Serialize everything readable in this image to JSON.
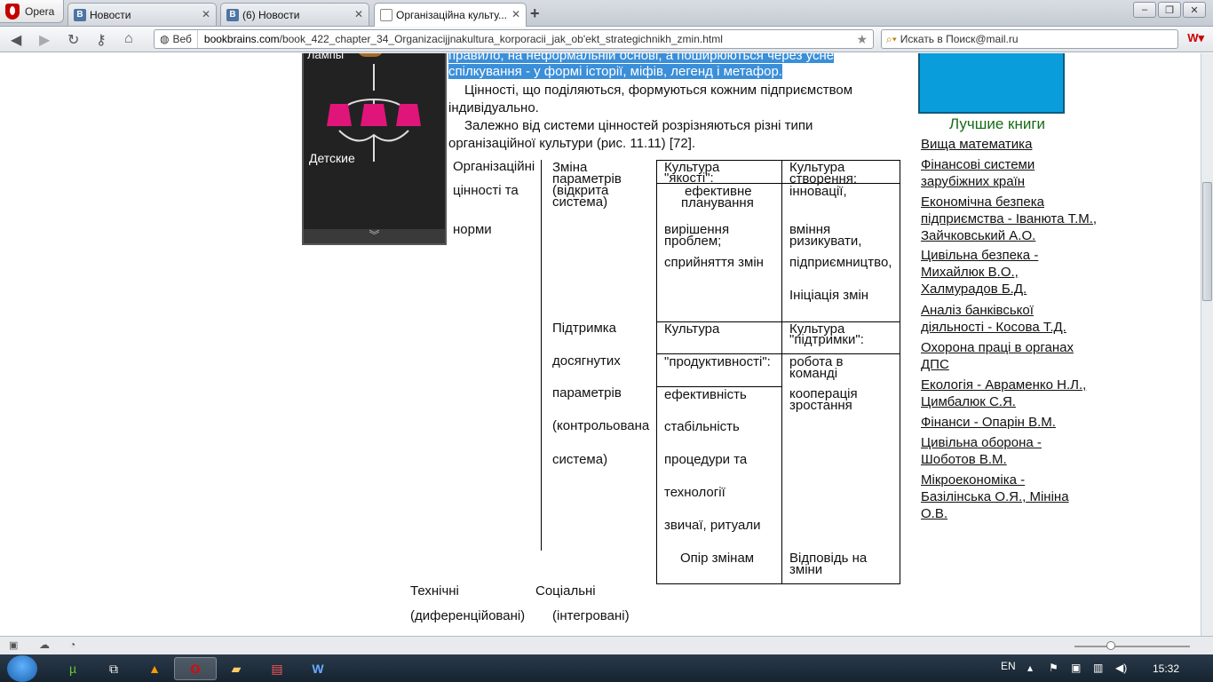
{
  "browser": {
    "menu_label": "Opera",
    "tabs": [
      {
        "label": "Новости",
        "icon": "vk-icon"
      },
      {
        "label": "(6) Новости",
        "icon": "vk-icon"
      },
      {
        "label": "Організаційна культу...",
        "icon": "document-icon"
      }
    ],
    "address": {
      "mode": "Веб",
      "domain": "bookbrains.com",
      "path": "/book_422_chapter_34_Organizacijjnakultura_korporacii_jak_ob'ekt_strategichnikh_zmin.html"
    },
    "search_placeholder": "Искать в Поиск@mail.ru",
    "window_controls": [
      "–",
      "❐",
      "✕"
    ]
  },
  "ad": {
    "title": "Лампы",
    "caption": "Детские"
  },
  "article": {
    "hl_line1": "правило, на неформальній основі, а поширюються через усне",
    "hl_line2": "спілкування - у формі історії, міфів, легенд і метафор.",
    "para1_line1": "Цінності, що поділяються, формуються кожним підприємством",
    "para1_line2": "індивідуально.",
    "para2_line1": "Залежно від системи цінностей розрізняються різні типи",
    "para2_line2": "організаційної культури (рис. 11.11) [72]."
  },
  "figure": {
    "left_label": [
      "Організаційні",
      "цінності та",
      "норми"
    ],
    "row1_label": [
      "Зміна",
      "параметрів",
      "(відкрита",
      "система)"
    ],
    "row2_label": [
      "Підтримка",
      "досягнутих",
      "параметрів",
      "(контрольована",
      "система)"
    ],
    "quality_title": [
      "Культура",
      "\"якості\":"
    ],
    "quality_items": [
      "ефективне",
      "планування",
      "вирішення",
      "проблем;",
      "сприйняття змін"
    ],
    "creation_title": [
      "Культура",
      "створення:"
    ],
    "creation_items": [
      "інновації,",
      "вміння",
      "ризикувати,",
      "підприємництво,",
      "Ініціація змін"
    ],
    "product_title": [
      "Культура",
      "\"продуктивності\":"
    ],
    "product_items": [
      "ефективність",
      "стабільність",
      "процедури та",
      "технології",
      "звичаї, ритуали",
      "Опір змінам"
    ],
    "support_title": [
      "Культура",
      "\"підтримки\":"
    ],
    "support_items": [
      "робота в",
      "команді",
      "кооперація",
      "зростання",
      "Відповідь на",
      "зміни"
    ],
    "bottom_left": [
      "Технічні",
      "(диференційовані)"
    ],
    "bottom_right": [
      "Соціальні",
      "(інтегровані)"
    ]
  },
  "sidebar": {
    "heading": "Лучшие книги",
    "books": [
      "Вища математика",
      "Фінансові системи зарубіжних країн",
      "Економічна безпека підприємства - Іванюта Т.М., Зайчковський А.О.",
      "Цивільна безпека - Михайлюк В.О., Халмурадов Б.Д.",
      "Аналіз банківської діяльності - Косова Т.Д.",
      "Охорона праці в органах ДПС",
      "Екологія - Авраменко Н.Л., Цимбалюк С.Я.",
      "Фінанси - Опарін В.М.",
      "Цивільна оборона - Шоботов В.М.",
      "Мікроекономіка - Базілінська О.Я., Мініна О.В."
    ]
  },
  "taskbar": {
    "lang": "EN",
    "clock": "15:32"
  }
}
